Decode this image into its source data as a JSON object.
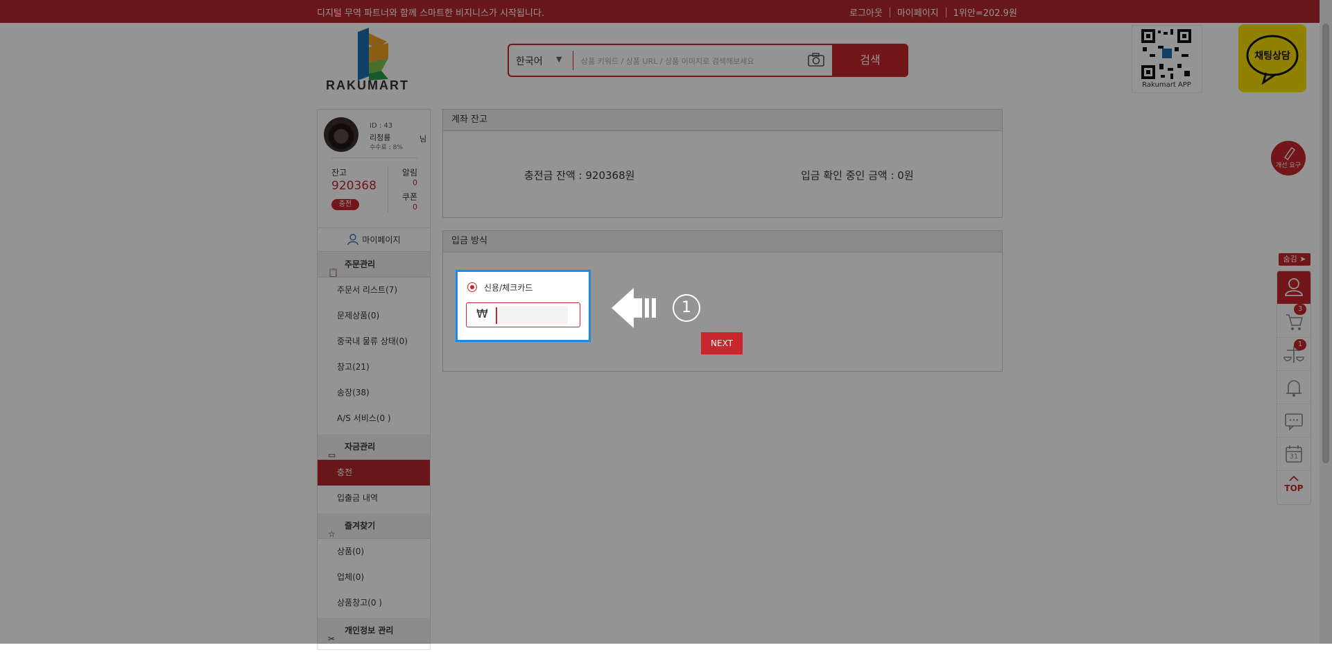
{
  "topbar": {
    "slogan": "디지털 무역 파트너와 함께 스마트한 비지니스가 시작됩니다.",
    "logout": "로그아웃",
    "mypage": "마이페이지",
    "rate": "1위안=202.9원"
  },
  "header": {
    "logo_text": "RAKUMART",
    "lang": "한국어",
    "search_placeholder": "상품 키워드 / 상품 URL / 상품 이미지로 검색해보세요",
    "search_button": "검색",
    "qr_label": "Rakumart APP",
    "kakao_label": "채팅상담"
  },
  "user": {
    "id": "ID : 43",
    "name": "리청룡",
    "suffix": "님",
    "fee": "수수료 : 8%",
    "balance_label": "잔고",
    "balance": "920368",
    "charge_badge": "충전",
    "alarm_label": "알림",
    "alarm_count": "0",
    "coupon_label": "쿠폰",
    "coupon_count": "0"
  },
  "sidebar": {
    "mypage": "마이페이지",
    "sections": [
      {
        "title": "주문관리",
        "items": [
          "주문서 리스트(7)",
          "문제상품(0)",
          "중국내 물류 상태(0)",
          "창고(21)",
          "송장(38)",
          "A/S 서비스(0 )"
        ]
      },
      {
        "title": "자금관리",
        "items": [
          "충전",
          "입출금 내역"
        ]
      },
      {
        "title": "즐겨찾기",
        "items": [
          "상품(0)",
          "업체(0)",
          "상품창고(0 )"
        ]
      },
      {
        "title": "개인정보 관리",
        "items": []
      }
    ]
  },
  "account": {
    "title": "계좌 잔고",
    "charge_balance": "충전금 잔액  : 920368원",
    "pending": "입금 확인 중인 금액  : 0원"
  },
  "deposit": {
    "title": "입금 방식",
    "method_label": "신용/체크카드",
    "currency_symbol": "₩",
    "amount_value": "",
    "step_number": "1",
    "next_button": "NEXT"
  },
  "rightbar": {
    "feedback": "개선 요구",
    "hide": "숨김 ➤",
    "cart_count": "3",
    "compare_count": "1",
    "calendar_day": "31",
    "top": "TOP"
  },
  "colors": {
    "brand": "#c7262d",
    "topbar": "#b4262b",
    "highlight": "#1e88e5",
    "kakao": "#f9e000"
  }
}
